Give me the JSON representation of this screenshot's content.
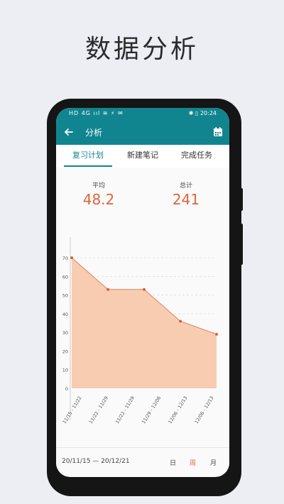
{
  "banner": {
    "title": "数据分析"
  },
  "status_bar": {
    "left": "HD 4G ııl ≋ ⚡ ✉",
    "right": "✱ ▯ 20:24"
  },
  "app_bar": {
    "title": "分析",
    "back_icon": "arrow-left-icon",
    "calendar_icon": "calendar-icon"
  },
  "tabs": [
    {
      "label": "复习计划",
      "active": true
    },
    {
      "label": "新建笔记",
      "active": false
    },
    {
      "label": "完成任务",
      "active": false
    }
  ],
  "stats": {
    "average": {
      "label": "平均",
      "value": "48.2"
    },
    "total": {
      "label": "总计",
      "value": "241"
    }
  },
  "chart_data": {
    "type": "area",
    "categories": [
      "11/15 - 11/22",
      "11/22 - 11/29",
      "11/22 - 11/29",
      "11/29 - 12/06",
      "12/06 - 12/13",
      "12/06 - 12/13"
    ],
    "x": [
      "11/15 - 11/22",
      "11/22 - 11/29",
      "11/29 - 12/06",
      "12/06 - 12/13",
      "12/06 - 12/13"
    ],
    "values": [
      70,
      53,
      53,
      36,
      29
    ],
    "yticks": [
      "0",
      "10",
      "20",
      "30",
      "40",
      "50",
      "60",
      "70"
    ],
    "ylim": [
      0,
      75
    ],
    "grid": true,
    "colors": {
      "fill": "#f8ccb0",
      "line": "#e0805a",
      "point": "#d9633c"
    }
  },
  "footer": {
    "range": "20/11/15 — 20/12/21",
    "options": [
      {
        "label": "日",
        "active": false
      },
      {
        "label": "周",
        "active": true
      },
      {
        "label": "月",
        "active": false
      }
    ]
  },
  "colors": {
    "primary": "#11858f",
    "accent": "#e0663b"
  }
}
